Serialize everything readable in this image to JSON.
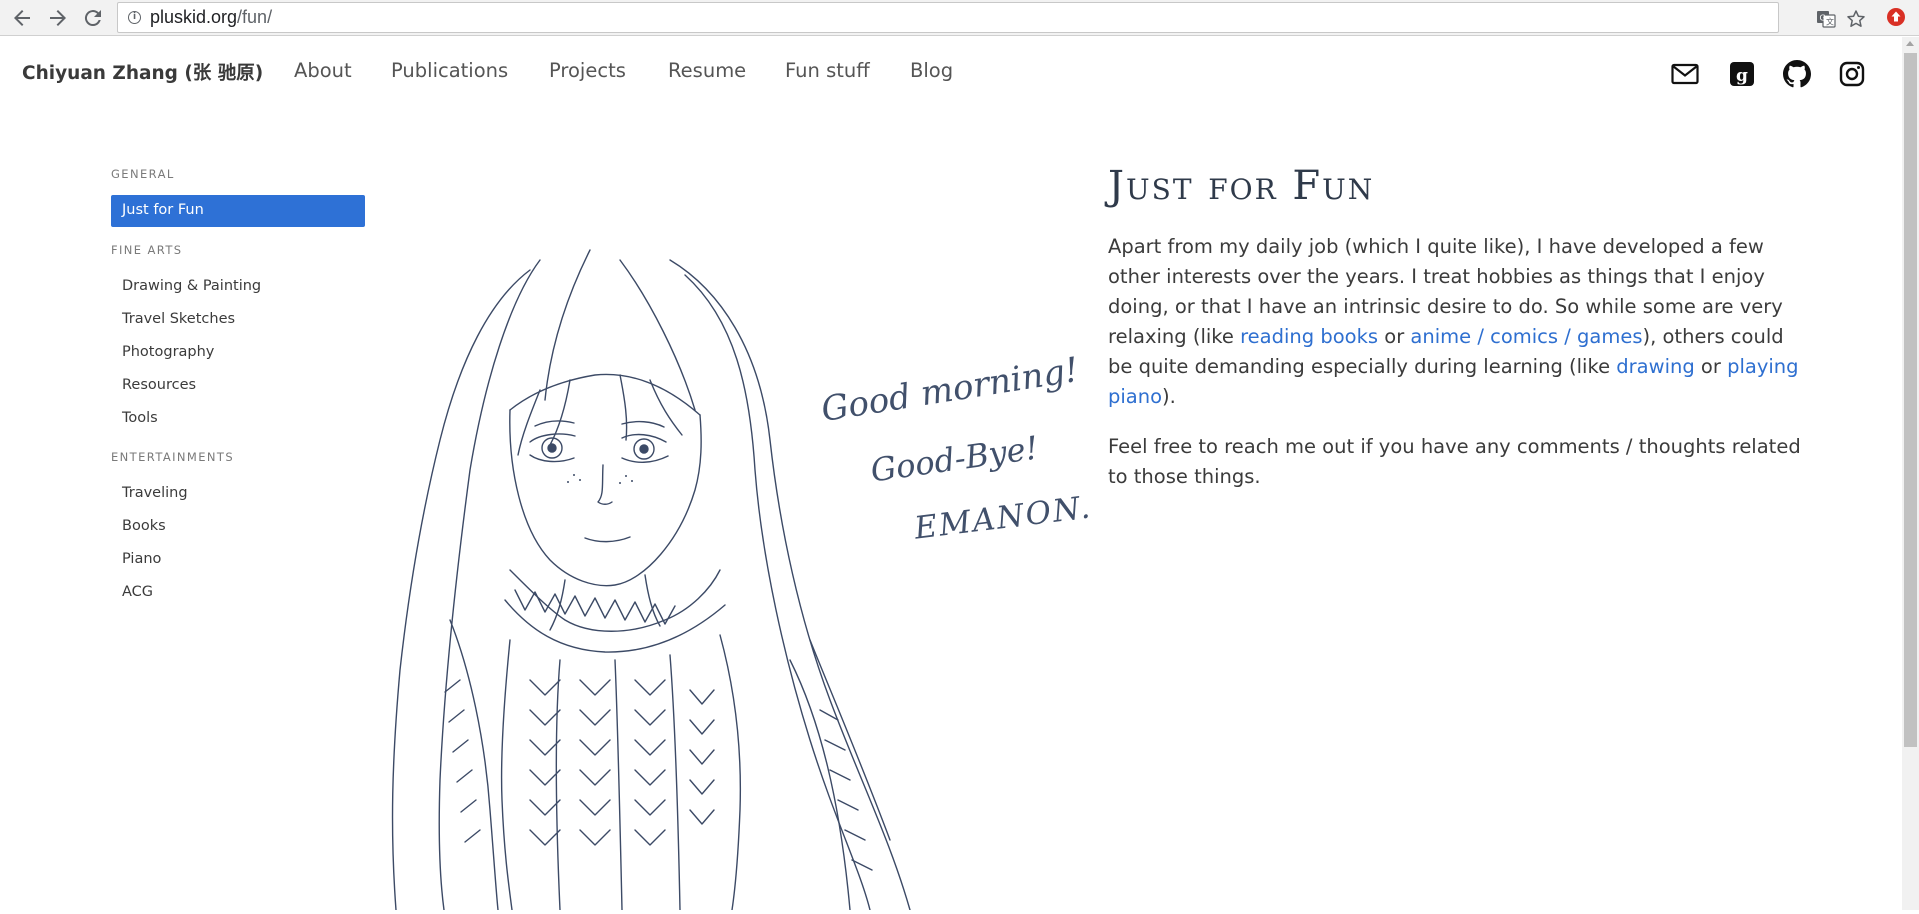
{
  "browser": {
    "back_icon": "back-arrow-icon",
    "forward_icon": "forward-arrow-icon",
    "reload_icon": "reload-icon",
    "url_host": "pluskid.org",
    "url_path": "/fun/",
    "translate_icon": "translate-icon",
    "bookmark_icon": "star-icon"
  },
  "header": {
    "brand": "Chiyuan Zhang (张 驰原)",
    "nav": [
      {
        "label": "About"
      },
      {
        "label": "Publications"
      },
      {
        "label": "Projects"
      },
      {
        "label": "Resume"
      },
      {
        "label": "Fun stuff"
      },
      {
        "label": "Blog"
      }
    ],
    "social": [
      "mail-icon",
      "google-scholar-icon",
      "github-icon",
      "instagram-icon"
    ]
  },
  "sidebar": {
    "sections": [
      {
        "title": "GENERAL",
        "items": [
          {
            "label": "Just for Fun",
            "active": true
          }
        ]
      },
      {
        "title": "FINE ARTS",
        "items": [
          {
            "label": "Drawing & Painting"
          },
          {
            "label": "Travel Sketches"
          },
          {
            "label": "Photography"
          },
          {
            "label": "Resources"
          },
          {
            "label": "Tools"
          }
        ]
      },
      {
        "title": "ENTERTAINMENTS",
        "items": [
          {
            "label": "Traveling"
          },
          {
            "label": "Books"
          },
          {
            "label": "Piano"
          },
          {
            "label": "ACG"
          }
        ]
      }
    ]
  },
  "sketch": {
    "lines": [
      "Good morning!",
      "Good-Bye!",
      "EMANON."
    ]
  },
  "main": {
    "title": "Just for Fun",
    "p1": {
      "t1": "Apart from my daily job (which I quite like), I have developed a few other interests over the years. I treat hobbies as things that I enjoy doing, or that I have an intrinsic desire to do. So while some are very relaxing (like ",
      "link1": "reading books",
      "t2": " or ",
      "link2": "anime / comics / games",
      "t3": "), others could be quite demanding especially during learning (like ",
      "link3": "drawing",
      "t4": " or ",
      "link4": "playing piano",
      "t5": ")."
    },
    "p2": "Feel free to reach me out if you have any comments / thoughts related to those things.",
    "link_color": "#2e6fd0"
  },
  "colors": {
    "accent": "#2e71d6",
    "text": "#3b3b3b",
    "muted": "#7a7a7a"
  }
}
